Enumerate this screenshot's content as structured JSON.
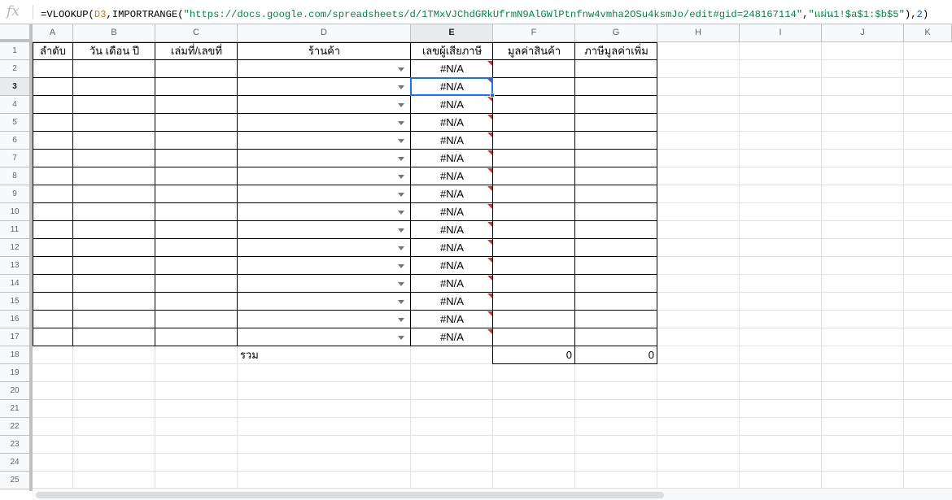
{
  "formula_bar": {
    "icon": "fx-icon",
    "tokens": [
      {
        "text": "=VLOOKUP(",
        "kind": "plain"
      },
      {
        "text": "D3",
        "kind": "ref"
      },
      {
        "text": ",IMPORTRANGE(",
        "kind": "plain"
      },
      {
        "text": "\"https://docs.google.com/spreadsheets/d/1TMxVJChdGRkUfrmN9AlGWlPtnfnw4vmha2OSu4ksmJo/edit#gid=248167114\"",
        "kind": "str"
      },
      {
        "text": ",",
        "kind": "plain"
      },
      {
        "text": "\"แผ่น1!$a$1:$b$5\"",
        "kind": "str"
      },
      {
        "text": "),",
        "kind": "plain"
      },
      {
        "text": "2",
        "kind": "num"
      },
      {
        "text": ")",
        "kind": "plain"
      }
    ]
  },
  "columns": [
    "A",
    "B",
    "C",
    "D",
    "E",
    "F",
    "G",
    "H",
    "I",
    "J",
    "K"
  ],
  "rows": [
    "1",
    "2",
    "3",
    "4",
    "5",
    "6",
    "7",
    "8",
    "9",
    "10",
    "11",
    "12",
    "13",
    "14",
    "15",
    "16",
    "17",
    "18",
    "19",
    "20",
    "21",
    "22",
    "23",
    "24",
    "25"
  ],
  "header_row": {
    "A": "ลำดับ",
    "B": "วัน เดือน ปี",
    "C": "เล่มที่/เลขที่",
    "D": "ร้านค้า",
    "E": "เลขผู้เสียภาษี",
    "F": "มูลค่าสินค้า",
    "G": "ภาษีมูลค่าเพิ่ม"
  },
  "error_value": "#N/A",
  "total_label": "รวม",
  "totals": {
    "F": "0",
    "G": "0"
  },
  "selected_cell": "E3",
  "colors": {
    "accent": "#1a73e8",
    "error_flag": "#c53929",
    "header_bg": "#f8f9fa"
  }
}
